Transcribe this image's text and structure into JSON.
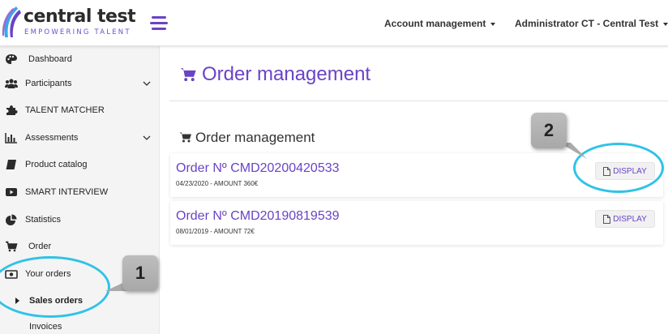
{
  "header": {
    "logo_name": "central test",
    "logo_tagline": "EMPOWERING TALENT",
    "account_menu": "Account management",
    "user_menu": "Administrator CT - Central Test"
  },
  "sidebar": {
    "items": [
      {
        "label": "Dashboard",
        "icon": "palette-icon"
      },
      {
        "label": "Participants",
        "icon": "users-icon",
        "has_children": true
      },
      {
        "label": "TALENT MATCHER",
        "icon": "puzzle-icon"
      },
      {
        "label": "Assessments",
        "icon": "bar-chart-icon",
        "has_children": true
      },
      {
        "label": "Product catalog",
        "icon": "book-icon"
      },
      {
        "label": "SMART INTERVIEW",
        "icon": "video-icon"
      },
      {
        "label": "Statistics",
        "icon": "pie-chart-icon"
      },
      {
        "label": "Order",
        "icon": "cart-icon"
      },
      {
        "label": "Your orders",
        "icon": "money-icon"
      }
    ],
    "subitems": [
      {
        "label": "Sales orders",
        "active": true
      },
      {
        "label": "Invoices",
        "active": false
      }
    ]
  },
  "main": {
    "page_title": "Order management",
    "section_title": "Order management",
    "orders": [
      {
        "title": "Order Nº CMD20200420533",
        "meta": "04/23/2020 - AMOUNT 360€",
        "action": "DISPLAY"
      },
      {
        "title": "Order Nº CMD20190819539",
        "meta": "08/01/2019 - AMOUNT 72€",
        "action": "DISPLAY"
      }
    ]
  },
  "annotations": {
    "callout_1": "1",
    "callout_2": "2",
    "ring_color": "#2fc3e6"
  },
  "colors": {
    "accent": "#6a43c7"
  }
}
